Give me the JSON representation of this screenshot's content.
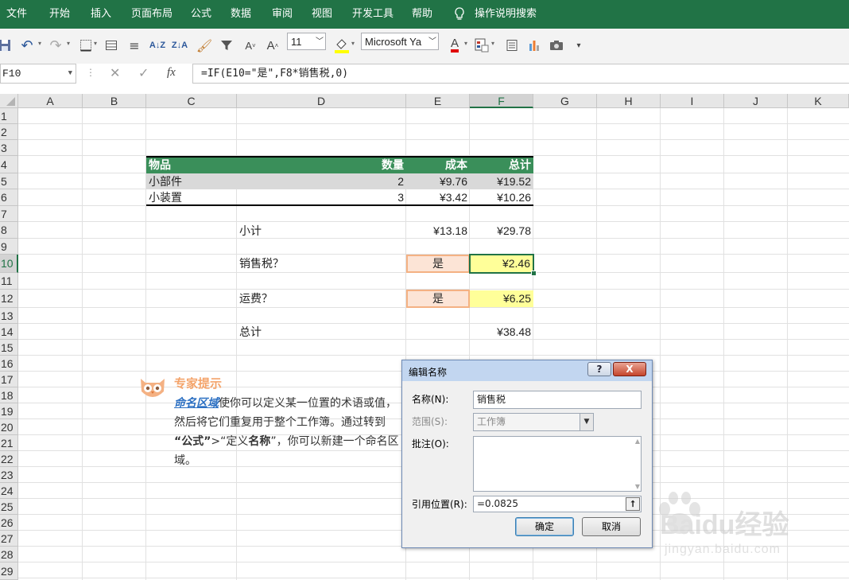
{
  "menu": [
    "文件",
    "开始",
    "插入",
    "页面布局",
    "公式",
    "数据",
    "审阅",
    "视图",
    "开发工具",
    "帮助"
  ],
  "tell_me": "操作说明搜索",
  "toolbar": {
    "font_size": "11",
    "font_name": "Microsoft Ya"
  },
  "formula_bar": {
    "name_box": "F10",
    "fx": "fx",
    "formula": "=IF(E10=\"是\",F8*销售税,0)"
  },
  "columns": [
    "A",
    "B",
    "C",
    "D",
    "E",
    "F",
    "G",
    "H",
    "I",
    "J",
    "K"
  ],
  "rows": [
    "1",
    "2",
    "3",
    "4",
    "5",
    "6",
    "7",
    "8",
    "9",
    "10",
    "11",
    "12",
    "13",
    "14",
    "15",
    "16",
    "17",
    "18",
    "19",
    "20",
    "21",
    "22",
    "23",
    "24",
    "25",
    "26",
    "27",
    "28",
    "29"
  ],
  "table": {
    "headers": [
      "物品",
      "数量",
      "成本",
      "总计"
    ],
    "rows": [
      {
        "item": "小部件",
        "qty": "2",
        "cost": "¥9.76",
        "total": "¥19.52"
      },
      {
        "item": "小装置",
        "qty": "3",
        "cost": "¥3.42",
        "total": "¥10.26"
      }
    ]
  },
  "summary": {
    "subtotal_label": "小计",
    "subtotal_cost": "¥13.18",
    "subtotal_total": "¥29.78",
    "tax_label": "销售税？",
    "tax_flag": "是",
    "tax_value": "¥2.46",
    "ship_label": "运费？",
    "ship_flag": "是",
    "ship_value": "¥6.25",
    "total_label": "总计",
    "total_value": "¥38.48"
  },
  "tip": {
    "title": "专家提示",
    "link": "命名区域",
    "line1": "使你可以定义某一位置的术语或值，",
    "line2": "然后将它们重复用于整个工作簿。通过转到",
    "line3_a": "“公式”",
    "line3_b": ">“定义",
    "line3_c": "名称",
    "line3_d": "”，你可以新建一个命名区",
    "line4": "域。"
  },
  "dialog": {
    "title": "编辑名称",
    "help": "?",
    "close": "X",
    "name_label": "名称(N):",
    "name_value": "销售税",
    "scope_label": "范围(S):",
    "scope_value": "工作簿",
    "comment_label": "批注(O):",
    "comment_value": "",
    "ref_label": "引用位置(R):",
    "ref_value": "=0.0825",
    "ok": "确定",
    "cancel": "取消"
  },
  "colors": {
    "accent": "#217346",
    "header_green": "#3a8f5a",
    "highlight_yellow": "#ffff99",
    "flag_fill": "#fce4d6",
    "flag_border": "#f4b183"
  },
  "watermark": {
    "brand": "Baidu经验",
    "url": "jingyan.baidu.com"
  }
}
